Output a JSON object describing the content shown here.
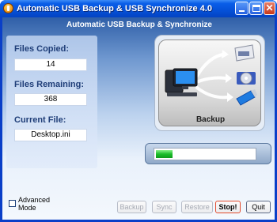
{
  "window": {
    "title": "Automatic USB Backup & USB Synchronize 4.0",
    "close_glyph": "✕"
  },
  "banner": "Automatic USB Backup & Synchronize",
  "stats": {
    "files_copied_label": "Files Copied:",
    "files_copied_value": "14",
    "files_remaining_label": "Files Remaining:",
    "files_remaining_value": "368",
    "current_file_label": "Current File:",
    "current_file_value": "Desktop.ini"
  },
  "backup_panel": {
    "label": "Backup",
    "icons": [
      "computer-icon",
      "external-drive-icon",
      "cd-icon",
      "usb-drive-icon"
    ]
  },
  "progress": {
    "value": 0.17
  },
  "advanced": {
    "label": "Advanced Mode",
    "checked": false
  },
  "buttons": {
    "backup": "Backup",
    "sync": "Sync",
    "restore": "Restore",
    "stop": "Stop!",
    "quit": "Quit"
  },
  "colors": {
    "title_bar": "#0551d8",
    "stop_border": "#e24a2c",
    "progress_green": "#1bbd2a"
  }
}
